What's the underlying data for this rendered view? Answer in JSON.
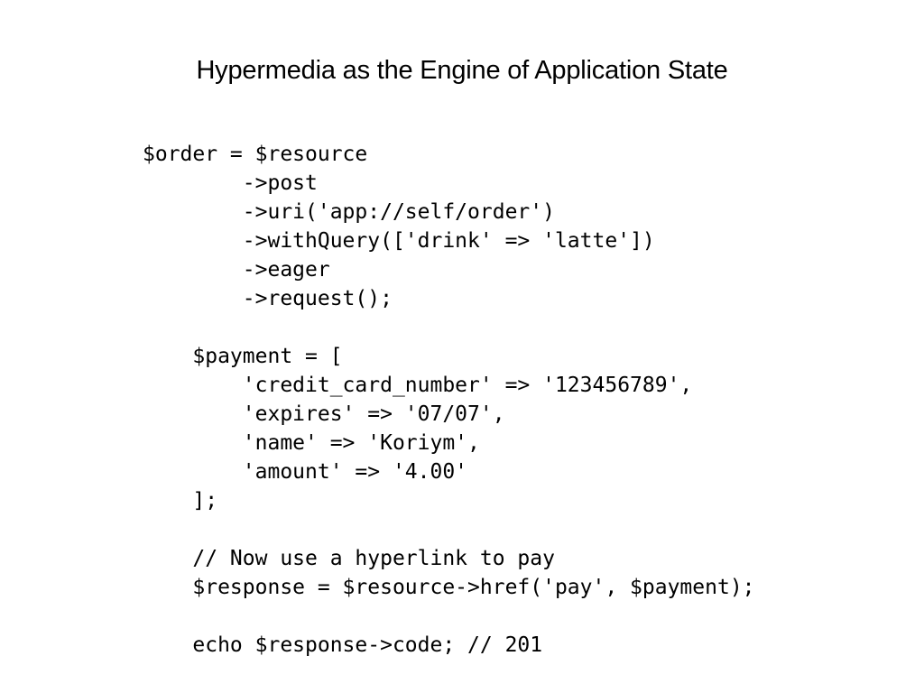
{
  "slide": {
    "title": "Hypermedia as the Engine of Application State",
    "code_lines": [
      "$order = $resource",
      "        ->post",
      "        ->uri('app://self/order')",
      "        ->withQuery(['drink' => 'latte'])",
      "        ->eager",
      "        ->request();",
      "",
      "    $payment = [",
      "        'credit_card_number' => '123456789',",
      "        'expires' => '07/07',",
      "        'name' => 'Koriym',",
      "        'amount' => '4.00'",
      "    ];",
      "",
      "    // Now use a hyperlink to pay",
      "    $response = $resource->href('pay', $payment);",
      "",
      "    echo $response->code; // 201"
    ]
  }
}
